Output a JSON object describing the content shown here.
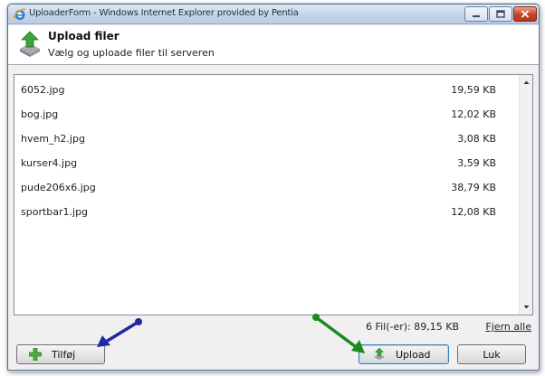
{
  "window": {
    "title": "UploaderForm - Windows Internet Explorer provided by Pentia"
  },
  "header": {
    "title": "Upload filer",
    "subtitle": "Vælg og uploade filer til serveren",
    "icon": "upload-icon"
  },
  "files": [
    {
      "name": "6052.jpg",
      "size": "19,59 KB"
    },
    {
      "name": "bog.jpg",
      "size": "12,02 KB"
    },
    {
      "name": "hvem_h2.jpg",
      "size": "3,08 KB"
    },
    {
      "name": "kurser4.jpg",
      "size": "3,59 KB"
    },
    {
      "name": "pude206x6.jpg",
      "size": "38,79 KB"
    },
    {
      "name": "sportbar1.jpg",
      "size": "12,08 KB"
    }
  ],
  "summary": {
    "text": "6 Fil(-er): 89,15 KB",
    "remove_all": "Fjern alle"
  },
  "buttons": {
    "add": "Tilføj",
    "upload": "Upload",
    "close": "Luk"
  },
  "colors": {
    "arrow_blue": "#1f2a9e",
    "arrow_green": "#1e8a1e",
    "close_button": "#c8482c"
  }
}
